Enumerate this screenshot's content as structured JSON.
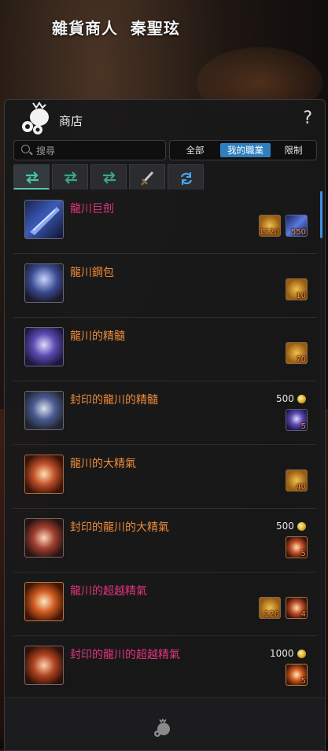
{
  "npc_title": "雜貨商人  秦聖玹",
  "shop": {
    "title": "商店",
    "help_icon": "?",
    "search_placeholder": "搜尋",
    "filters": [
      {
        "label": "全部",
        "active": false
      },
      {
        "label": "我的職業",
        "active": true
      },
      {
        "label": "限制",
        "active": false
      }
    ],
    "tabs": [
      {
        "icon": "exchange-icon",
        "active": true
      },
      {
        "icon": "exchange-icon",
        "active": false
      },
      {
        "icon": "exchange-icon",
        "active": false
      },
      {
        "icon": "sword-icon",
        "active": false
      },
      {
        "icon": "refresh-icon",
        "active": false
      }
    ]
  },
  "items": [
    {
      "name": "龍川巨劍",
      "color": "pink",
      "icon": "greatsword-icon",
      "price": null,
      "costs": [
        {
          "icon": "gold-token-icon",
          "qty": "1120"
        },
        {
          "icon": "blue-crystal-icon",
          "qty": "550"
        }
      ]
    },
    {
      "name": "龍川鋼包",
      "color": "orange",
      "icon": "steel-bag-icon",
      "price": null,
      "costs": [
        {
          "icon": "gold-token-icon",
          "qty": "10"
        }
      ]
    },
    {
      "name": "龍川的精髓",
      "color": "orange",
      "icon": "essence-icon",
      "price": null,
      "costs": [
        {
          "icon": "gold-token-icon",
          "qty": "70"
        }
      ]
    },
    {
      "name": "封印的龍川的精髓",
      "color": "orange",
      "icon": "sealed-essence-icon",
      "price": "500",
      "costs": [
        {
          "icon": "essence-icon",
          "qty": "5"
        }
      ]
    },
    {
      "name": "龍川的大精氣",
      "color": "orange",
      "icon": "great-spirit-icon",
      "price": null,
      "costs": [
        {
          "icon": "gold-token-icon",
          "qty": "40"
        }
      ]
    },
    {
      "name": "封印的龍川的大精氣",
      "color": "orange",
      "icon": "sealed-great-spirit-icon",
      "price": "500",
      "costs": [
        {
          "icon": "great-spirit-icon",
          "qty": "5"
        }
      ]
    },
    {
      "name": "龍川的超越精氣",
      "color": "pink",
      "icon": "transcend-spirit-icon",
      "price": null,
      "costs": [
        {
          "icon": "gold-token-icon",
          "qty": "120"
        },
        {
          "icon": "great-spirit-icon",
          "qty": "4"
        }
      ]
    },
    {
      "name": "封印的龍川的超越精氣",
      "color": "pink",
      "icon": "sealed-transcend-spirit-icon",
      "price": "1000",
      "costs": [
        {
          "icon": "transcend-spirit-icon",
          "qty": "5"
        }
      ]
    }
  ],
  "footer": {
    "icon": "money-bag-icon"
  }
}
